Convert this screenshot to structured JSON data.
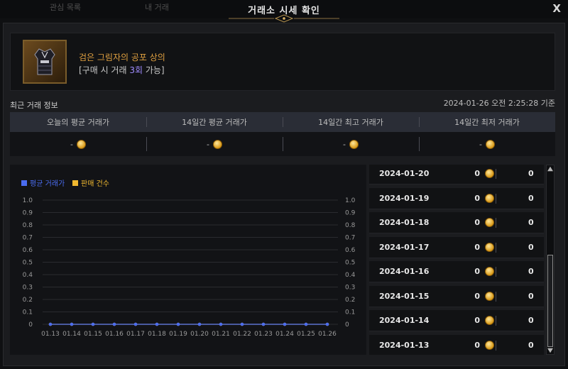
{
  "background_tabs": [
    "관심 목록",
    "내 거래"
  ],
  "window": {
    "title": "거래소 시세 확인",
    "close_label": "X"
  },
  "item": {
    "name": "검은 그림자의 공포 상의",
    "limit_prefix": "[구매 시 거래 ",
    "limit_count": "3회",
    "limit_suffix": " 가능]",
    "icon": "dark-armor-top-icon"
  },
  "recent": {
    "title": "최근 거래 정보",
    "timestamp": "2024-01-26 오전 2:25:28 기준",
    "headers": [
      "오늘의 평균 거래가",
      "14일간 평균 거래가",
      "14일간 최고 거래가",
      "14일간 최저 거래가"
    ],
    "values": [
      "-",
      "-",
      "-",
      "-"
    ]
  },
  "chart_data": {
    "type": "line",
    "legend": [
      "평균 거래가",
      "판매 건수"
    ],
    "colors": {
      "avg_price": "#4a6cf0",
      "sales_count": "#f0b830"
    },
    "x": [
      "01.13",
      "01.14",
      "01.15",
      "01.16",
      "01.17",
      "01.18",
      "01.19",
      "01.20",
      "01.21",
      "01.22",
      "01.23",
      "01.24",
      "01.25",
      "01.26"
    ],
    "series": [
      {
        "name": "평균 거래가",
        "values": [
          0,
          0,
          0,
          0,
          0,
          0,
          0,
          0,
          0,
          0,
          0,
          0,
          0,
          0
        ]
      },
      {
        "name": "판매 건수",
        "values": [
          0,
          0,
          0,
          0,
          0,
          0,
          0,
          0,
          0,
          0,
          0,
          0,
          0,
          0
        ]
      }
    ],
    "yticks": [
      "0",
      "0.1",
      "0.2",
      "0.3",
      "0.4",
      "0.5",
      "0.6",
      "0.7",
      "0.8",
      "0.9",
      "1.0"
    ],
    "ylim": [
      0,
      1
    ],
    "grid": true,
    "legend_position": "top-left"
  },
  "history": [
    {
      "date": "2024-01-20",
      "price": "0",
      "count": "0"
    },
    {
      "date": "2024-01-19",
      "price": "0",
      "count": "0"
    },
    {
      "date": "2024-01-18",
      "price": "0",
      "count": "0"
    },
    {
      "date": "2024-01-17",
      "price": "0",
      "count": "0"
    },
    {
      "date": "2024-01-16",
      "price": "0",
      "count": "0"
    },
    {
      "date": "2024-01-15",
      "price": "0",
      "count": "0"
    },
    {
      "date": "2024-01-14",
      "price": "0",
      "count": "0"
    },
    {
      "date": "2024-01-13",
      "price": "0",
      "count": "0"
    }
  ]
}
